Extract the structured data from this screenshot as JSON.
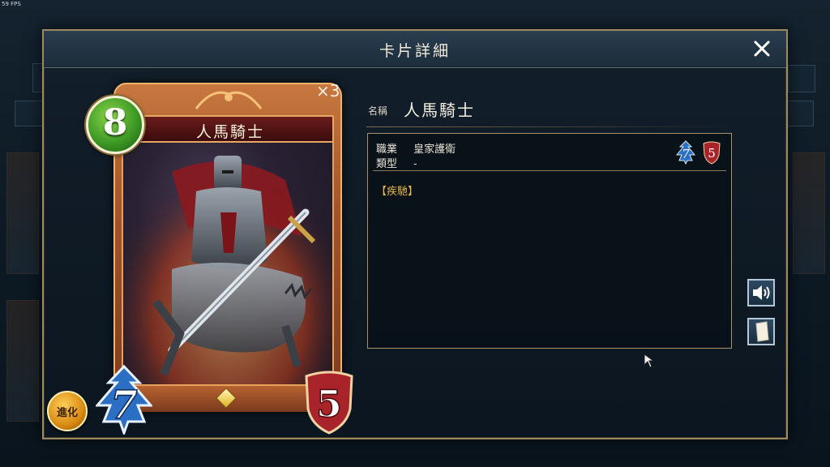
{
  "fps": "59 FPS",
  "modal": {
    "title": "卡片詳細",
    "close_icon": "close-icon"
  },
  "card": {
    "name": "人馬騎士",
    "cost": "8",
    "attack": "7",
    "defense": "5",
    "count": "×3",
    "evolve_label": "進化"
  },
  "details": {
    "name_label": "名稱",
    "name_value": "人馬騎士",
    "class_label": "職業",
    "class_value": "皇家護衛",
    "type_label": "類型",
    "type_value": "-",
    "attack": "7",
    "defense": "5",
    "skill": "【疾馳】"
  },
  "side_buttons": [
    {
      "icon": "speaker-icon"
    },
    {
      "icon": "card-flip-icon"
    }
  ],
  "colors": {
    "attack_blue": "#2a6fc4",
    "defense_red": "#a8232a",
    "cost_green": "#3e9a25",
    "skill_gold": "#e3b64a",
    "frame_gold": "#9c8a61"
  }
}
